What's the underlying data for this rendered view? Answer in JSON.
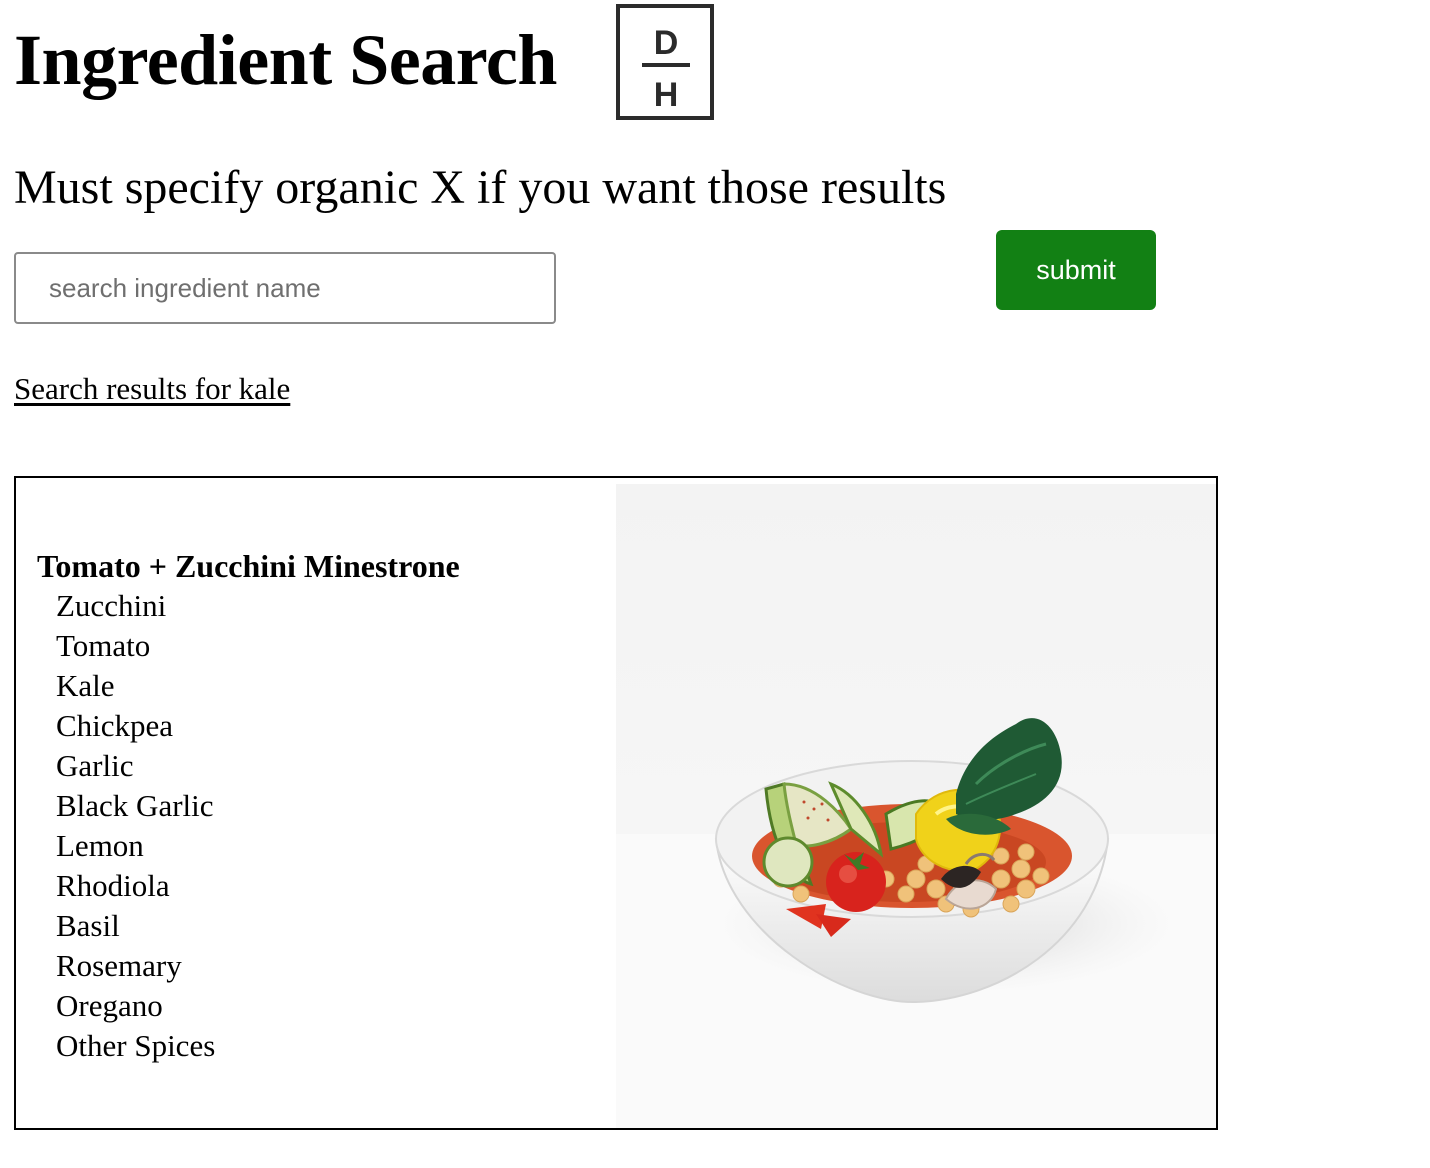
{
  "page": {
    "title": "Ingredient Search",
    "subtitle": "Must specify organic X if you want those results"
  },
  "logo": {
    "top_letter": "D",
    "bottom_letter": "H"
  },
  "search": {
    "placeholder": "search ingredient name",
    "value": "",
    "submit_label": "submit"
  },
  "results": {
    "heading": "Search results for kale",
    "recipes": [
      {
        "name": "Tomato + Zucchini Minestrone",
        "ingredients": [
          "Zucchini",
          "Tomato",
          "Kale",
          "Chickpea",
          "Garlic",
          "Black Garlic",
          "Lemon",
          "Rhodiola",
          "Basil",
          "Rosemary",
          "Oregano",
          "Other Spices"
        ]
      }
    ]
  },
  "colors": {
    "submit_button": "#128014",
    "logo_stroke": "#2b2b2b"
  }
}
